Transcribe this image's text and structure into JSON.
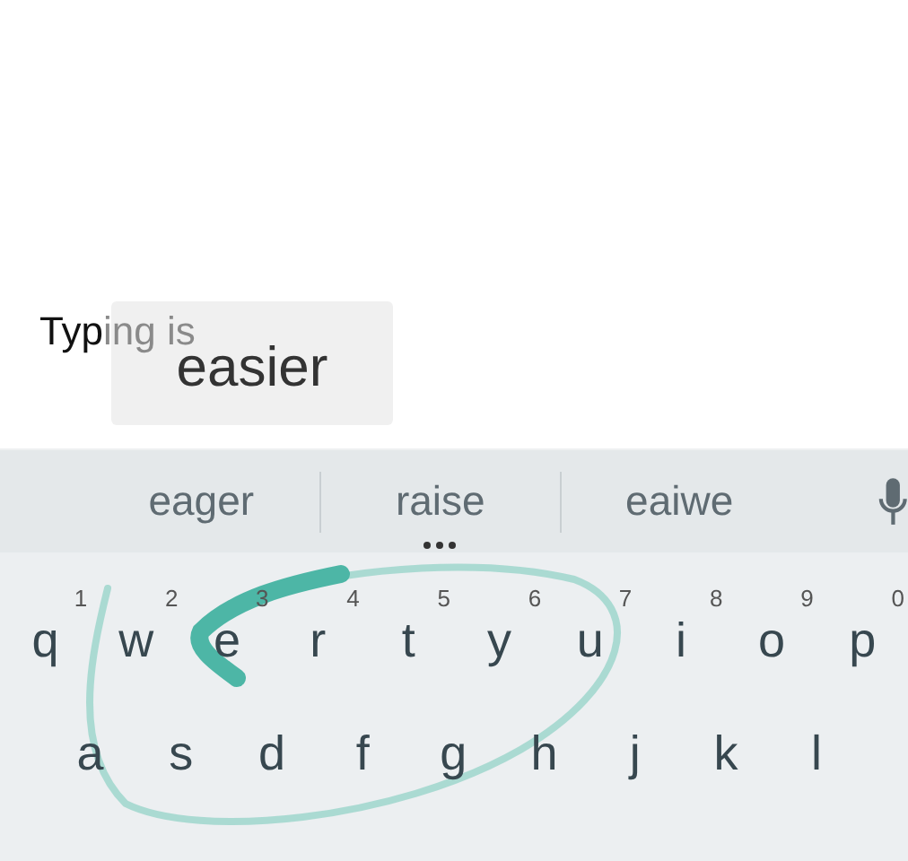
{
  "text_field": {
    "typed": "Typ",
    "composing": "ing is"
  },
  "gesture_preview": {
    "word": "easier"
  },
  "suggestions": [
    {
      "label": "eager",
      "more": false
    },
    {
      "label": "raise",
      "more": true
    },
    {
      "label": "eaiwe",
      "more": false
    }
  ],
  "keyboard": {
    "rows": [
      {
        "keys": [
          {
            "label": "q",
            "hint": "1"
          },
          {
            "label": "w",
            "hint": "2"
          },
          {
            "label": "e",
            "hint": "3"
          },
          {
            "label": "r",
            "hint": "4"
          },
          {
            "label": "t",
            "hint": "5"
          },
          {
            "label": "y",
            "hint": "6"
          },
          {
            "label": "u",
            "hint": "7"
          },
          {
            "label": "i",
            "hint": "8"
          },
          {
            "label": "o",
            "hint": "9"
          },
          {
            "label": "p",
            "hint": "0"
          }
        ]
      },
      {
        "keys": [
          {
            "label": "a"
          },
          {
            "label": "s"
          },
          {
            "label": "d"
          },
          {
            "label": "f"
          },
          {
            "label": "g"
          },
          {
            "label": "h"
          },
          {
            "label": "j"
          },
          {
            "label": "k"
          },
          {
            "label": "l"
          }
        ]
      }
    ]
  }
}
